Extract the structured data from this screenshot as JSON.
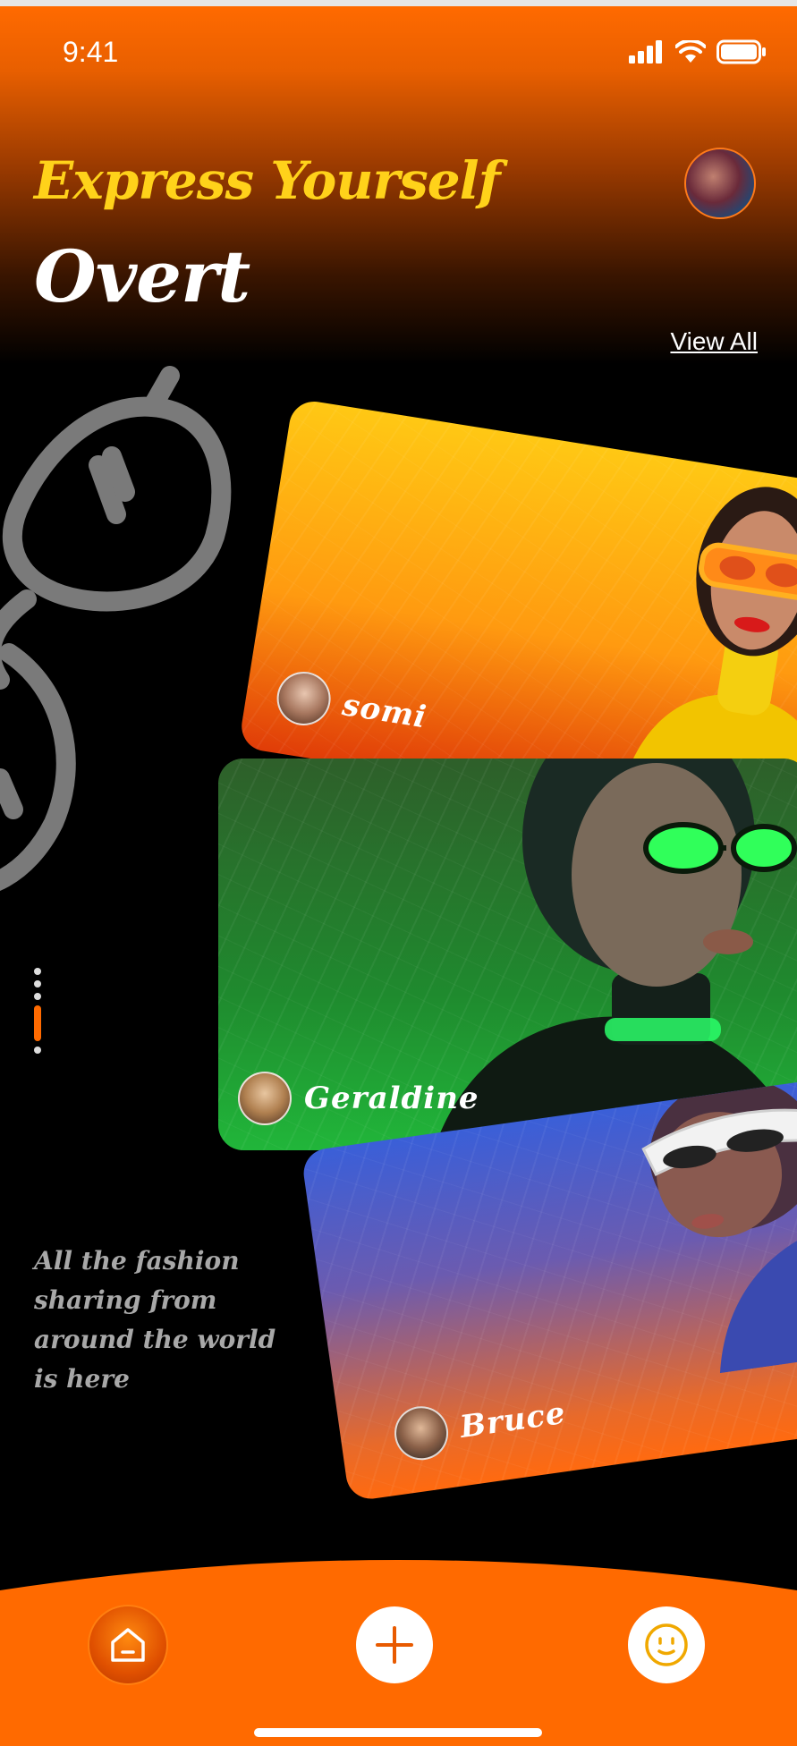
{
  "status_bar": {
    "time": "9:41"
  },
  "header": {
    "tagline": "Express Yourself",
    "app_name": "Overt",
    "view_all_label": "View All"
  },
  "cards": [
    {
      "username": "somi",
      "theme": "#ffc814"
    },
    {
      "username": "Geraldine",
      "theme": "#21b63a"
    },
    {
      "username": "Bruce",
      "theme": "#3a5fd8"
    }
  ],
  "pager": {
    "total": 5,
    "active_index": 3
  },
  "description": "All the fashion sharing from around the world is here",
  "tab_bar": {
    "items": [
      {
        "name": "home",
        "icon": "home-icon"
      },
      {
        "name": "add",
        "icon": "plus-icon"
      },
      {
        "name": "profile",
        "icon": "smiley-icon"
      }
    ]
  },
  "colors": {
    "accent": "#ff6a00",
    "tagline": "#ffd21a",
    "background": "#000000"
  }
}
